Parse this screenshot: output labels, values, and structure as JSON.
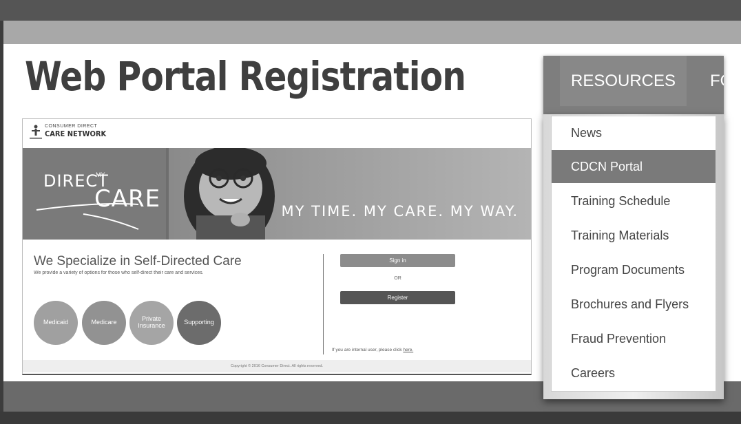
{
  "slide": {
    "title": "Web Portal Registration"
  },
  "portal": {
    "logo_small": "CONSUMER DIRECT",
    "logo_big": "CARE NETWORK",
    "brand_direct": "DIRECT",
    "brand_my": "MY",
    "brand_care": "CARE",
    "tagline": "MY TIME. MY CARE. MY WAY.",
    "heading": "We Specialize in Self-Directed Care",
    "subheading": "We provide a variety of options for those who self-direct their care and services.",
    "circles": [
      "Medicaid",
      "Medicare",
      "Private Insurance",
      "Supporting"
    ],
    "sign_in_label": "Sign in",
    "or_label": "OR",
    "register_label": "Register",
    "internal_text": "If you are internal user, please click",
    "internal_link": "here.",
    "copyright": "Copyright © 2016 Consumer Direct. All rights reserved."
  },
  "nav": {
    "resources": "RESOURCES",
    "next_partial": "FO"
  },
  "dropdown": {
    "items": [
      "News",
      "CDCN Portal",
      "Training Schedule",
      "Training Materials",
      "Program Documents",
      "Brochures and Flyers",
      "Fraud Prevention",
      "Careers"
    ],
    "active": "CDCN Portal"
  },
  "colors": {
    "nav_bg": "#7e7e7e",
    "active_item": "#7a7a7a",
    "register_button": "#555555",
    "sign_in_button": "#8c8c8c"
  }
}
